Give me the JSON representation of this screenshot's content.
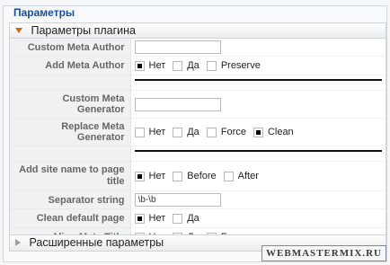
{
  "outer_legend": "Параметры",
  "plugin_pane": {
    "title": "Параметры плагина",
    "rows": {
      "custom_meta_author": {
        "label": "Custom Meta Author",
        "value": ""
      },
      "add_meta_author": {
        "label": "Add Meta Author",
        "options": [
          "Нет",
          "Да",
          "Preserve"
        ],
        "selected": 0
      },
      "custom_meta_generator": {
        "label": "Custom Meta Generator",
        "value": ""
      },
      "replace_meta_generator": {
        "label": "Replace Meta Generator",
        "options": [
          "Нет",
          "Да",
          "Force",
          "Clean"
        ],
        "selected": 3
      },
      "add_site_name": {
        "label": "Add site name to page title",
        "options": [
          "Нет",
          "Before",
          "After"
        ],
        "selected": 0
      },
      "separator_string": {
        "label": "Separator string",
        "value": "\\b-\\b"
      },
      "clean_default_page": {
        "label": "Clean default page",
        "options": [
          "Нет",
          "Да"
        ],
        "selected": 0
      },
      "align_meta_title": {
        "label": "Align Meta Title",
        "options": [
          "Нет",
          "Да",
          "Force"
        ],
        "selected": 0
      }
    }
  },
  "advanced_pane": {
    "title": "Расширенные параметры"
  },
  "watermark": "WEBMASTERMIX.RU"
}
